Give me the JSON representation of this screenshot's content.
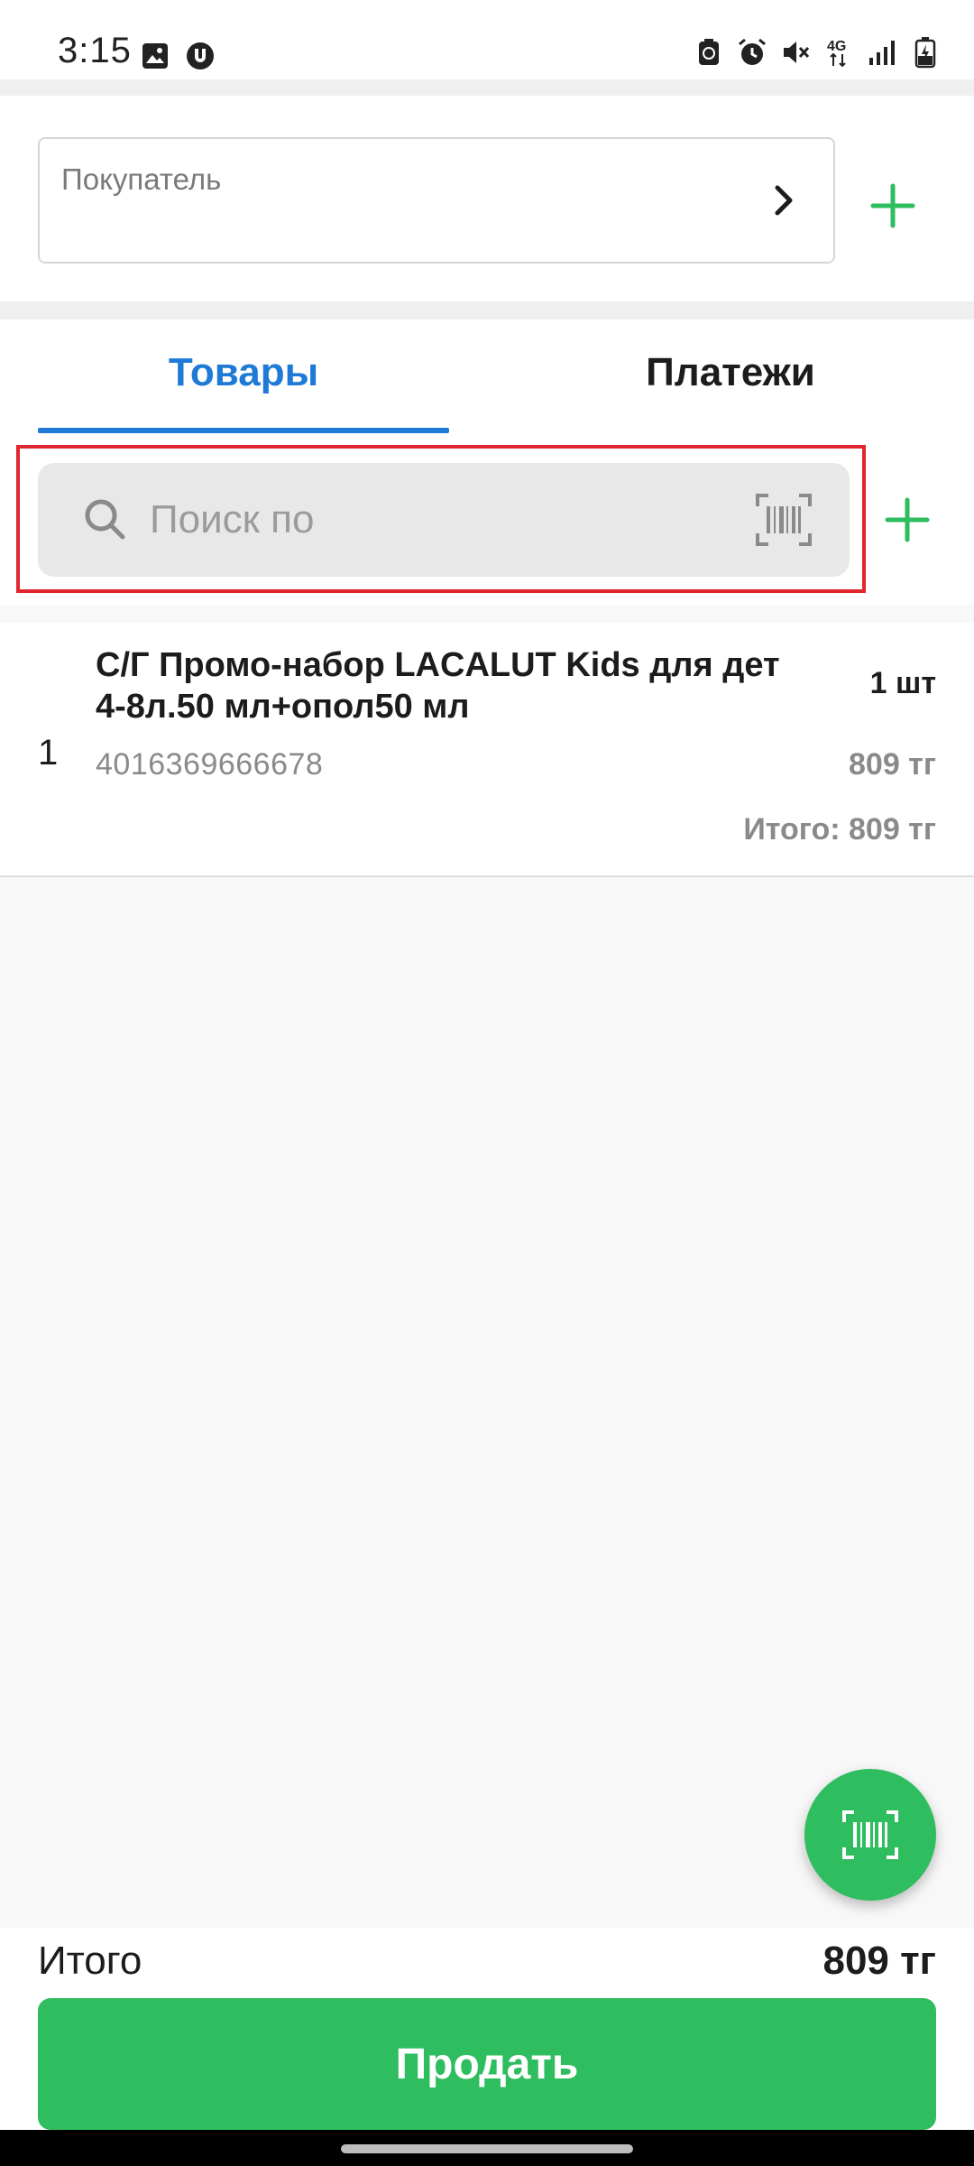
{
  "status_bar": {
    "time": "3:15",
    "left_icons": [
      "image-icon",
      "u-badge-icon"
    ],
    "right_icons": [
      "recycle-battery-icon",
      "alarm-icon",
      "mute-icon",
      "4g-icon",
      "signal-icon",
      "battery-charging-icon"
    ],
    "network_label": "4G"
  },
  "customer": {
    "label": "Покупатель",
    "chevron_icon": "chevron-right-icon",
    "add_icon": "plus-icon"
  },
  "tabs": [
    {
      "label": "Товары",
      "active": true
    },
    {
      "label": "Платежи",
      "active": false
    }
  ],
  "search": {
    "placeholder": "Поиск по",
    "value": "",
    "icon": "search-icon",
    "scan_icon": "barcode-scan-icon",
    "add_icon": "plus-icon"
  },
  "items": [
    {
      "index": "1",
      "name": "С/Г Промо-набор LACALUT Kids для дет 4-8л.50 мл+опол50 мл",
      "quantity": "1 шт",
      "barcode": "4016369666678",
      "price": "809 тг",
      "total": "Итого: 809 тг"
    }
  ],
  "footer": {
    "total_label": "Итого",
    "total_value": "809 тг",
    "sell_label": "Продать"
  },
  "colors": {
    "accent_blue": "#1e7ad6",
    "accent_green": "#2ebd5f",
    "highlight_red": "#e0262e"
  }
}
